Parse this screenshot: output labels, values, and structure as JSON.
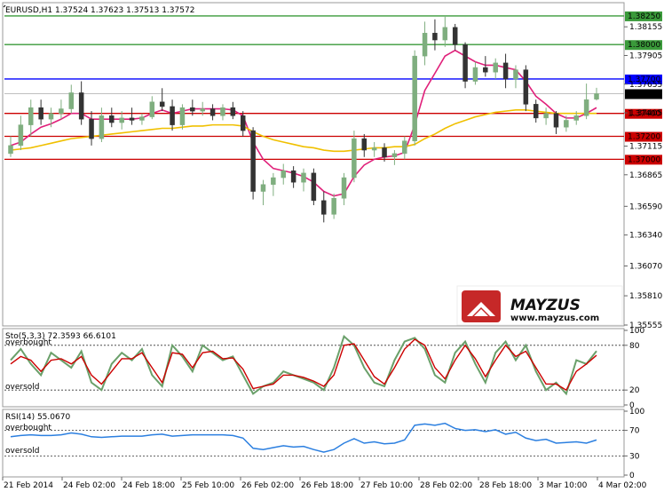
{
  "header": {
    "symbol_line": "EURUSD,H1  1.37524 1.37623 1.37513 1.37572"
  },
  "price_axis": {
    "ticks": [
      "1.38155",
      "1.37905",
      "1.37655",
      "1.37405",
      "1.37115",
      "1.36865",
      "1.36590",
      "1.36340",
      "1.36070",
      "1.35810",
      "1.35555"
    ]
  },
  "levels": [
    {
      "label": "1.38250",
      "value": 1.3825,
      "color": "#3a9a3a"
    },
    {
      "label": "1.38000",
      "value": 1.38,
      "color": "#3a9a3a"
    },
    {
      "label": "1.37700",
      "value": 1.377,
      "color": "#0000ff"
    },
    {
      "label": "1.37400",
      "value": 1.374,
      "color": "#cc0000"
    },
    {
      "label": "1.37200",
      "value": 1.372,
      "color": "#cc0000"
    },
    {
      "label": "1.37000",
      "value": 1.37,
      "color": "#cc0000"
    }
  ],
  "current_price": {
    "label": "1.37572",
    "value": 1.37572
  },
  "time_axis": {
    "labels": [
      "21 Feb 2014",
      "24 Feb 02:00",
      "24 Feb 18:00",
      "25 Feb 10:00",
      "26 Feb 02:00",
      "26 Feb 18:00",
      "27 Feb 10:00",
      "28 Feb 02:00",
      "28 Feb 18:00",
      "3 Mar 10:00",
      "4 Mar 02:00"
    ]
  },
  "stoch": {
    "title": "Sto(5,3,3) 72.3593 66.6101",
    "overbought_label": "overbought",
    "oversold_label": "oversold",
    "ticks": [
      "100",
      "80",
      "20",
      "0"
    ]
  },
  "rsi": {
    "title": "RSI(14) 55.0670",
    "overbought_label": "overbought",
    "oversold_label": "oversold",
    "ticks": [
      "100",
      "70",
      "30",
      "0"
    ]
  },
  "logo": {
    "brand": "MAYZUS",
    "url": "www.mayzus.com"
  },
  "colors": {
    "bull": "#7fae7f",
    "bear": "#333333",
    "ma_fast": "#e0207a",
    "ma_slow": "#f0c000",
    "stoch_main": "#6aa06a",
    "stoch_signal": "#cc0000",
    "rsi_line": "#2b7fe0"
  },
  "chart_data": {
    "type": "candlestick",
    "symbol": "EURUSD",
    "timeframe": "H1",
    "x_start": "21 Feb 2014",
    "x_end": "4 Mar 02:00",
    "ylim": [
      1.35555,
      1.3835
    ],
    "last_bar": {
      "open": 1.37524,
      "high": 1.37623,
      "low": 1.37513,
      "close": 1.37572
    },
    "candles": [
      [
        1.3705,
        1.372,
        1.3702,
        1.3712
      ],
      [
        1.3712,
        1.3738,
        1.3708,
        1.373
      ],
      [
        1.373,
        1.3752,
        1.372,
        1.3745
      ],
      [
        1.3745,
        1.3752,
        1.373,
        1.3735
      ],
      [
        1.3735,
        1.3745,
        1.3728,
        1.374
      ],
      [
        1.374,
        1.3752,
        1.3735,
        1.3744
      ],
      [
        1.3744,
        1.3765,
        1.374,
        1.3758
      ],
      [
        1.3758,
        1.3768,
        1.373,
        1.3735
      ],
      [
        1.3735,
        1.3742,
        1.3712,
        1.3718
      ],
      [
        1.3718,
        1.3745,
        1.3715,
        1.3738
      ],
      [
        1.3738,
        1.3745,
        1.3728,
        1.3732
      ],
      [
        1.3732,
        1.3742,
        1.3726,
        1.3736
      ],
      [
        1.3736,
        1.3745,
        1.373,
        1.3734
      ],
      [
        1.3734,
        1.374,
        1.373,
        1.3737
      ],
      [
        1.3737,
        1.3755,
        1.3735,
        1.375
      ],
      [
        1.375,
        1.3762,
        1.3742,
        1.3746
      ],
      [
        1.3746,
        1.3752,
        1.3725,
        1.373
      ],
      [
        1.373,
        1.3748,
        1.3726,
        1.3745
      ],
      [
        1.3745,
        1.3752,
        1.3738,
        1.3742
      ],
      [
        1.3742,
        1.375,
        1.3738,
        1.3744
      ],
      [
        1.3744,
        1.3748,
        1.3734,
        1.3738
      ],
      [
        1.3738,
        1.3748,
        1.3734,
        1.3745
      ],
      [
        1.3745,
        1.375,
        1.3735,
        1.3738
      ],
      [
        1.3738,
        1.3742,
        1.372,
        1.3725
      ],
      [
        1.3725,
        1.3728,
        1.3665,
        1.3672
      ],
      [
        1.3672,
        1.3682,
        1.366,
        1.3678
      ],
      [
        1.3678,
        1.3688,
        1.3668,
        1.3684
      ],
      [
        1.3684,
        1.3696,
        1.3678,
        1.369
      ],
      [
        1.369,
        1.3694,
        1.3675,
        1.368
      ],
      [
        1.368,
        1.3692,
        1.3672,
        1.3688
      ],
      [
        1.3688,
        1.3692,
        1.366,
        1.3664
      ],
      [
        1.3664,
        1.3672,
        1.3645,
        1.3652
      ],
      [
        1.3652,
        1.367,
        1.3648,
        1.3666
      ],
      [
        1.3666,
        1.3688,
        1.366,
        1.3684
      ],
      [
        1.3684,
        1.3725,
        1.368,
        1.3718
      ],
      [
        1.3718,
        1.3722,
        1.3702,
        1.3708
      ],
      [
        1.3708,
        1.3715,
        1.3702,
        1.371
      ],
      [
        1.371,
        1.3714,
        1.3698,
        1.3702
      ],
      [
        1.3702,
        1.3708,
        1.3695,
        1.3705
      ],
      [
        1.3705,
        1.372,
        1.37,
        1.3716
      ],
      [
        1.3716,
        1.3795,
        1.3712,
        1.379
      ],
      [
        1.379,
        1.382,
        1.3782,
        1.381
      ],
      [
        1.381,
        1.3822,
        1.3795,
        1.3804
      ],
      [
        1.3804,
        1.3825,
        1.3798,
        1.3815
      ],
      [
        1.3815,
        1.3818,
        1.3795,
        1.38
      ],
      [
        1.38,
        1.3802,
        1.3762,
        1.3768
      ],
      [
        1.3768,
        1.3785,
        1.3765,
        1.378
      ],
      [
        1.378,
        1.379,
        1.3772,
        1.3776
      ],
      [
        1.3776,
        1.3788,
        1.377,
        1.3784
      ],
      [
        1.3784,
        1.3792,
        1.3762,
        1.377
      ],
      [
        1.377,
        1.3782,
        1.3762,
        1.3778
      ],
      [
        1.3778,
        1.3782,
        1.3742,
        1.3748
      ],
      [
        1.3748,
        1.3752,
        1.3732,
        1.3736
      ],
      [
        1.3736,
        1.3745,
        1.373,
        1.374
      ],
      [
        1.374,
        1.3742,
        1.3722,
        1.3728
      ],
      [
        1.3728,
        1.3738,
        1.3724,
        1.3734
      ],
      [
        1.3734,
        1.3742,
        1.373,
        1.3738
      ],
      [
        1.3738,
        1.3766,
        1.3735,
        1.3752
      ],
      [
        1.37524,
        1.37623,
        1.37513,
        1.37572
      ]
    ],
    "series": [
      {
        "values": [
          1.3712,
          1.3715,
          1.3722,
          1.3728,
          1.3731,
          1.3735,
          1.374,
          1.374,
          1.3735,
          1.3735,
          1.3735,
          1.3735,
          1.3735,
          1.3736,
          1.374,
          1.3743,
          1.374,
          1.3742,
          1.3744,
          1.3744,
          1.3744,
          1.3744,
          1.3743,
          1.3738,
          1.3715,
          1.37,
          1.3692,
          1.369,
          1.3688,
          1.3685,
          1.368,
          1.3672,
          1.3668,
          1.367,
          1.3685,
          1.3695,
          1.37,
          1.3702,
          1.3703,
          1.3706,
          1.373,
          1.376,
          1.3775,
          1.379,
          1.3795,
          1.379,
          1.3785,
          1.3782,
          1.3782,
          1.378,
          1.3778,
          1.3768,
          1.3755,
          1.3748,
          1.374,
          1.3736,
          1.3736,
          1.374,
          1.3745
        ]
      },
      {
        "values": [
          1.3708,
          1.3709,
          1.371,
          1.3712,
          1.3714,
          1.3716,
          1.3718,
          1.3719,
          1.372,
          1.3721,
          1.3722,
          1.3723,
          1.3724,
          1.3725,
          1.3726,
          1.3727,
          1.3727,
          1.3728,
          1.3729,
          1.3729,
          1.373,
          1.373,
          1.373,
          1.3729,
          1.3724,
          1.372,
          1.3717,
          1.3715,
          1.3713,
          1.3711,
          1.371,
          1.3708,
          1.3707,
          1.3707,
          1.3708,
          1.3709,
          1.371,
          1.371,
          1.3711,
          1.3711,
          1.3713,
          1.3718,
          1.3722,
          1.3727,
          1.3731,
          1.3734,
          1.3737,
          1.3739,
          1.3741,
          1.3742,
          1.3743,
          1.3743,
          1.3742,
          1.3741,
          1.374,
          1.374,
          1.374,
          1.374,
          1.374
        ]
      }
    ],
    "stoch_main": [
      60,
      75,
      55,
      40,
      70,
      60,
      50,
      72,
      30,
      20,
      55,
      70,
      60,
      75,
      40,
      25,
      80,
      65,
      45,
      80,
      70,
      60,
      65,
      40,
      15,
      25,
      30,
      45,
      40,
      35,
      30,
      20,
      50,
      92,
      80,
      50,
      30,
      25,
      60,
      85,
      90,
      75,
      40,
      30,
      70,
      85,
      55,
      30,
      70,
      85,
      60,
      80,
      45,
      20,
      30,
      15,
      60,
      55,
      72.36
    ],
    "stoch_signal": [
      55,
      65,
      60,
      45,
      60,
      62,
      55,
      65,
      40,
      28,
      45,
      62,
      62,
      70,
      50,
      30,
      70,
      68,
      50,
      70,
      72,
      62,
      63,
      48,
      22,
      25,
      28,
      40,
      40,
      37,
      32,
      25,
      40,
      80,
      82,
      60,
      38,
      28,
      50,
      75,
      88,
      80,
      50,
      35,
      60,
      80,
      62,
      38,
      60,
      80,
      65,
      72,
      50,
      28,
      28,
      20,
      45,
      55,
      66.61
    ],
    "rsi": [
      60,
      62,
      63,
      62,
      62,
      63,
      66,
      64,
      60,
      59,
      60,
      61,
      61,
      61,
      63,
      64,
      61,
      62,
      63,
      63,
      63,
      63,
      62,
      58,
      42,
      40,
      43,
      46,
      44,
      45,
      40,
      36,
      40,
      50,
      57,
      50,
      52,
      49,
      50,
      55,
      78,
      80,
      78,
      81,
      73,
      70,
      71,
      68,
      71,
      64,
      67,
      58,
      54,
      56,
      50,
      51,
      52,
      50,
      55.07
    ]
  }
}
